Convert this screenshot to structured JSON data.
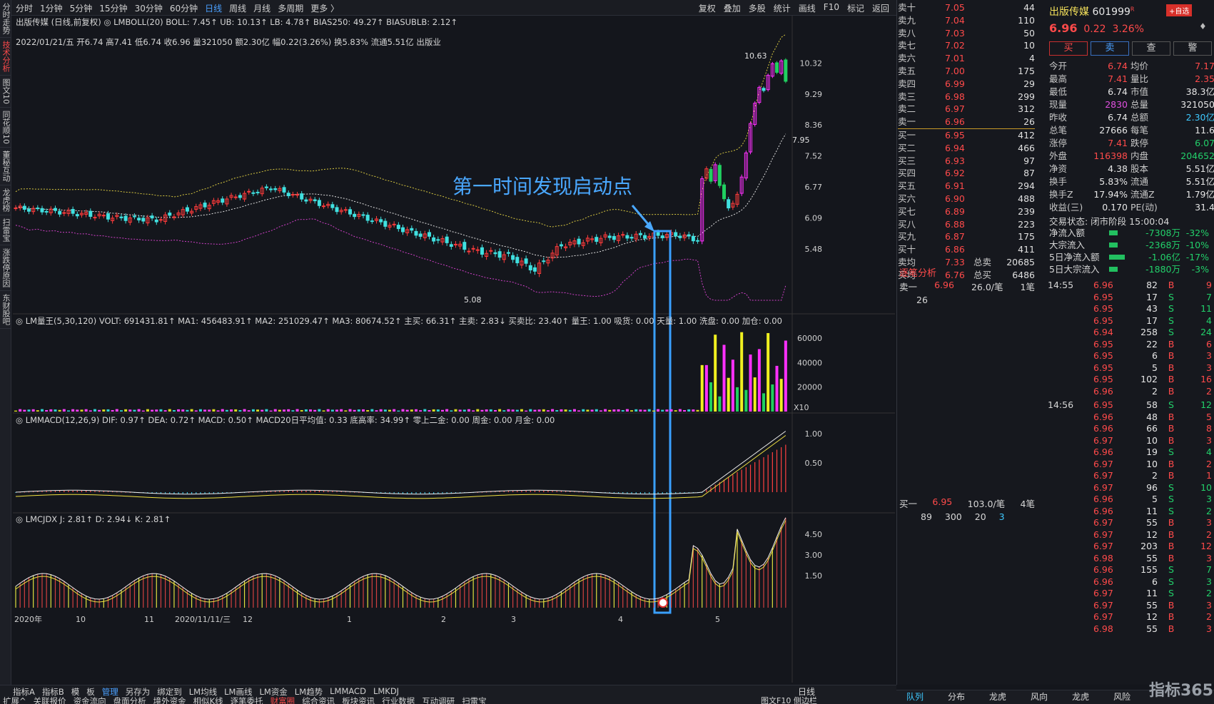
{
  "left_tabs": [
    "分时走势",
    "技术分析",
    "图文10",
    "同花顺10",
    "董秘互动",
    "龙虎榜",
    "扫雷宝",
    "涨跌停原因",
    "东财股吧"
  ],
  "toolbar": {
    "periods": [
      "分时",
      "1分钟",
      "5分钟",
      "15分钟",
      "30分钟",
      "60分钟",
      "日线",
      "周线",
      "月线",
      "多周期",
      "更多 〉"
    ],
    "right": [
      "复权",
      "叠加",
      "多股",
      "统计",
      "画线",
      "F10",
      "标记",
      "返回"
    ]
  },
  "header": {
    "legend_line": "出版传媒 (日线,前复权) ◎ LMBOLL(20) BOLL: 7.45↑ UB: 10.13↑ LB: 4.78↑ BIAS250: 49.27↑ BIASUBLB: 2.12↑",
    "ohlc_line": "2022/01/21/五 开6.74 高7.41 低6.74 收6.96 量321050 额2.30亿 幅0.22(3.26%) 换5.83% 流通5.51亿 出版业"
  },
  "price_axis": [
    "10.32",
    "9.29",
    "8.36",
    "7.52",
    "6.77",
    "6.09",
    "5.48"
  ],
  "price_tag": "7.95",
  "high_label": "10.63",
  "low_label": "5.08",
  "vol_legend": "◎ LM量王(5,30,120) VOLT: 691431.81↑ MA1: 456483.91↑ MA2: 251029.47↑ MA3: 80674.52↑ 主买: 66.31↑ 主卖: 2.83↓ 买卖比: 23.40↑ 量王: 1.00 吸货: 0.00 天量: 1.00 洗盘: 0.00 加仓: 0.00",
  "vol_axis": [
    "60000",
    "40000",
    "20000"
  ],
  "vol_unit": "X10",
  "macd_legend": "◎ LMMACD(12,26,9) DIF: 0.97↑ DEA: 0.72↑ MACD: 0.50↑ MACD20日平均值: 0.33 底高率: 34.99↑ 零上二金: 0.00 周金: 0.00 月金: 0.00",
  "macd_axis": [
    "1.00",
    "0.50"
  ],
  "kdj_legend": "◎ LMCJDX J: 2.81↑ D: 2.94↓ K: 2.81↑",
  "kdj_axis": [
    "4.50",
    "3.00",
    "1.50"
  ],
  "date_axis": [
    "2020年",
    "10",
    "11",
    "2020/11/11/三",
    "12",
    "1",
    "2",
    "3",
    "4",
    "5"
  ],
  "annotation": "第一时间发现启动点",
  "bottom": {
    "tabs1": [
      "指标A",
      "指标B",
      "模",
      "板",
      "管理",
      "另存为",
      "绑定到",
      "LM均线",
      "LM画线",
      "LM资金",
      "LM趋势",
      "LMMACD",
      "LMKDJ"
    ],
    "tabs2": [
      "扩展^",
      "关联报价",
      "资金流向",
      "盘面分析",
      "境外资金",
      "相似K线",
      "逐笔委托",
      "财富圈",
      "综合资讯",
      "板块资讯",
      "行业数据",
      "互动调研",
      "扫雷宝"
    ],
    "period_label": "日线",
    "f10": "图文F10 侧边栏"
  },
  "orderbook": {
    "asks": [
      [
        "卖十",
        "7.05",
        "44"
      ],
      [
        "卖九",
        "7.04",
        "110"
      ],
      [
        "卖八",
        "7.03",
        "50"
      ],
      [
        "卖七",
        "7.02",
        "10"
      ],
      [
        "卖六",
        "7.01",
        "4"
      ],
      [
        "卖五",
        "7.00",
        "175"
      ],
      [
        "卖四",
        "6.99",
        "29"
      ],
      [
        "卖三",
        "6.98",
        "299"
      ],
      [
        "卖二",
        "6.97",
        "312"
      ],
      [
        "卖一",
        "6.96",
        "26"
      ]
    ],
    "bids": [
      [
        "买一",
        "6.95",
        "412"
      ],
      [
        "买二",
        "6.94",
        "466"
      ],
      [
        "买三",
        "6.93",
        "97"
      ],
      [
        "买四",
        "6.92",
        "87"
      ],
      [
        "买五",
        "6.91",
        "294"
      ],
      [
        "买六",
        "6.90",
        "488"
      ],
      [
        "买七",
        "6.89",
        "239"
      ],
      [
        "买八",
        "6.88",
        "223"
      ],
      [
        "买九",
        "6.87",
        "175"
      ],
      [
        "买十",
        "6.86",
        "411"
      ]
    ],
    "avg": [
      [
        "卖均",
        "7.33",
        "总卖",
        "20685"
      ],
      [
        "买均",
        "6.76",
        "总买",
        "6486"
      ]
    ]
  },
  "tick_title": "逐笔分析",
  "tick_sell": {
    "label": "卖一",
    "price": "6.96",
    "per": "26.0/笔",
    "count": "1笔",
    "vol": "26"
  },
  "tick_buy": {
    "label": "买一",
    "price": "6.95",
    "per": "103.0/笔",
    "count": "4笔",
    "vols": [
      "89",
      "300",
      "20",
      "3"
    ]
  },
  "stock": {
    "name": "出版传媒",
    "code": "601999",
    "price": "6.96",
    "change": "0.22",
    "pct": "3.26%",
    "buttons": [
      "买",
      "卖",
      "查",
      "警"
    ],
    "watch": "+自选"
  },
  "quote": [
    [
      "今开",
      "6.74",
      "均价",
      "7.17"
    ],
    [
      "最高",
      "7.41",
      "量比",
      "2.35"
    ],
    [
      "最低",
      "6.74",
      "市值",
      "38.3亿"
    ],
    [
      "现量",
      "2830",
      "总量",
      "321050"
    ],
    [
      "昨收",
      "6.74",
      "总额",
      "2.30亿"
    ],
    [
      "总笔",
      "27666",
      "每笔",
      "11.6"
    ],
    [
      "涨停",
      "7.41",
      "跌停",
      "6.07"
    ],
    [
      "外盘",
      "116398",
      "内盘",
      "204652"
    ],
    [
      "净资",
      "4.38",
      "股本",
      "5.51亿"
    ],
    [
      "换手",
      "5.83%",
      "流通",
      "5.51亿"
    ],
    [
      "换手Z",
      "17.94%",
      "流通Z",
      "1.79亿"
    ],
    [
      "收益(三)",
      "0.170",
      "PE(动)",
      "31.4"
    ]
  ],
  "trade_status": "交易状态: 闭市阶段 15:00:04",
  "flows": [
    [
      "净流入额",
      "-7308万",
      "-32%"
    ],
    [
      "大宗流入",
      "-2368万",
      "-10%"
    ],
    [
      "5日净流入额",
      "-1.06亿",
      "-17%"
    ],
    [
      "5日大宗流入",
      "-1880万",
      "-3%"
    ]
  ],
  "ticks1_time": "14:55",
  "ticks1": [
    [
      "6.96",
      "82",
      "B",
      "9"
    ],
    [
      "6.95",
      "17",
      "S",
      "7"
    ],
    [
      "6.95",
      "43",
      "S",
      "11"
    ],
    [
      "6.95",
      "17",
      "S",
      "4"
    ],
    [
      "6.94",
      "258",
      "S",
      "24"
    ],
    [
      "6.95",
      "22",
      "B",
      "6"
    ],
    [
      "6.95",
      "6",
      "B",
      "3"
    ],
    [
      "6.95",
      "5",
      "B",
      "3"
    ],
    [
      "6.95",
      "102",
      "B",
      "16"
    ],
    [
      "6.96",
      "2",
      "B",
      "2"
    ]
  ],
  "ticks2_time": "14:56",
  "ticks2": [
    [
      "6.95",
      "58",
      "S",
      "12"
    ],
    [
      "6.96",
      "48",
      "B",
      "5"
    ],
    [
      "6.96",
      "66",
      "B",
      "8"
    ],
    [
      "6.97",
      "10",
      "B",
      "3"
    ],
    [
      "6.96",
      "19",
      "S",
      "4"
    ],
    [
      "6.97",
      "10",
      "B",
      "2"
    ],
    [
      "6.97",
      "2",
      "B",
      "1"
    ],
    [
      "6.97",
      "96",
      "S",
      "10"
    ],
    [
      "6.96",
      "5",
      "S",
      "3"
    ],
    [
      "6.96",
      "11",
      "S",
      "2"
    ],
    [
      "6.97",
      "55",
      "B",
      "3"
    ],
    [
      "6.97",
      "12",
      "B",
      "2"
    ],
    [
      "6.97",
      "203",
      "B",
      "12"
    ],
    [
      "6.98",
      "55",
      "B",
      "3"
    ],
    [
      "6.96",
      "155",
      "S",
      "7"
    ],
    [
      "6.96",
      "6",
      "S",
      "3"
    ],
    [
      "6.97",
      "11",
      "S",
      "2"
    ],
    [
      "6.97",
      "55",
      "B",
      "3"
    ],
    [
      "6.97",
      "12",
      "B",
      "2"
    ],
    [
      "6.98",
      "55",
      "B",
      "3"
    ]
  ],
  "right_bottom": [
    "队列",
    "分布",
    "龙虎",
    "风向",
    "龙虎",
    "风险"
  ],
  "watermark": "指标365"
}
